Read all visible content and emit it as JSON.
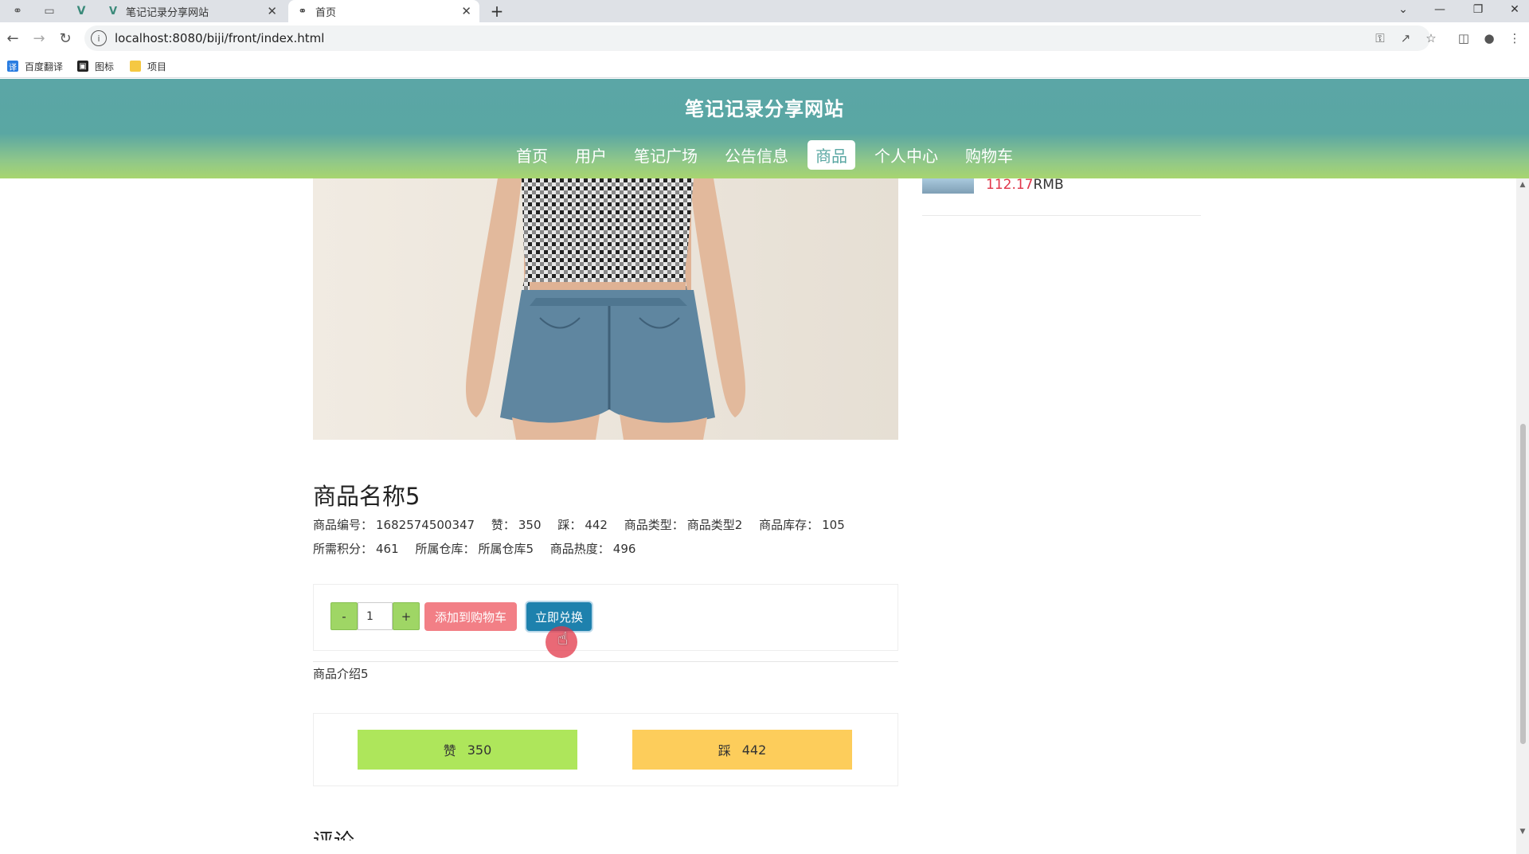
{
  "browser": {
    "tabs": [
      {
        "title": "笔记记录分享网站",
        "icon": "vue-logo-icon"
      },
      {
        "title": "首页",
        "icon": "globe-icon"
      }
    ],
    "new_tab": "+",
    "address": "localhost:8080/biji/front/index.html",
    "bookmarks": [
      {
        "label": "百度翻译",
        "icon": "baidu-translate-icon"
      },
      {
        "label": "图标",
        "icon": "image-icon"
      },
      {
        "label": "项目",
        "icon": "folder-icon"
      }
    ]
  },
  "site": {
    "title": "笔记记录分享网站",
    "nav": [
      "首页",
      "用户",
      "笔记广场",
      "公告信息",
      "商品",
      "个人中心",
      "购物车"
    ],
    "active_nav": "商品",
    "header_colors": {
      "top": "#5ba6a6",
      "bottom": "#a8d56f"
    }
  },
  "product": {
    "name": "商品名称5",
    "line1": [
      {
        "label": "商品编号：",
        "value": "1682574500347"
      },
      {
        "label": "赞：",
        "value": "350"
      },
      {
        "label": "踩：",
        "value": "442"
      },
      {
        "label": "商品类型：",
        "value": "商品类型2"
      },
      {
        "label": "商品库存：",
        "value": "105"
      }
    ],
    "line2": [
      {
        "label": "所需积分：",
        "value": "461"
      },
      {
        "label": "所属仓库：",
        "value": "所属仓库5"
      },
      {
        "label": "商品热度：",
        "value": "496"
      }
    ],
    "intro": "商品介绍5"
  },
  "buy": {
    "minus": "-",
    "quantity": "1",
    "plus": "+",
    "add_to_cart": "添加到购物车",
    "redeem": "立即兑换"
  },
  "votes": {
    "like_label": "赞",
    "like_count": "350",
    "dislike_label": "踩",
    "dislike_count": "442"
  },
  "comments_heading": "评论",
  "sidebar": {
    "price_value": "112.17",
    "price_unit": "RMB"
  },
  "colors": {
    "accent": "#5aa7a3",
    "like": "#aee65b",
    "dislike": "#fdcd5b",
    "add_to_cart": "#f27f86",
    "redeem": "#1e81ad",
    "price": "#e0364a"
  }
}
